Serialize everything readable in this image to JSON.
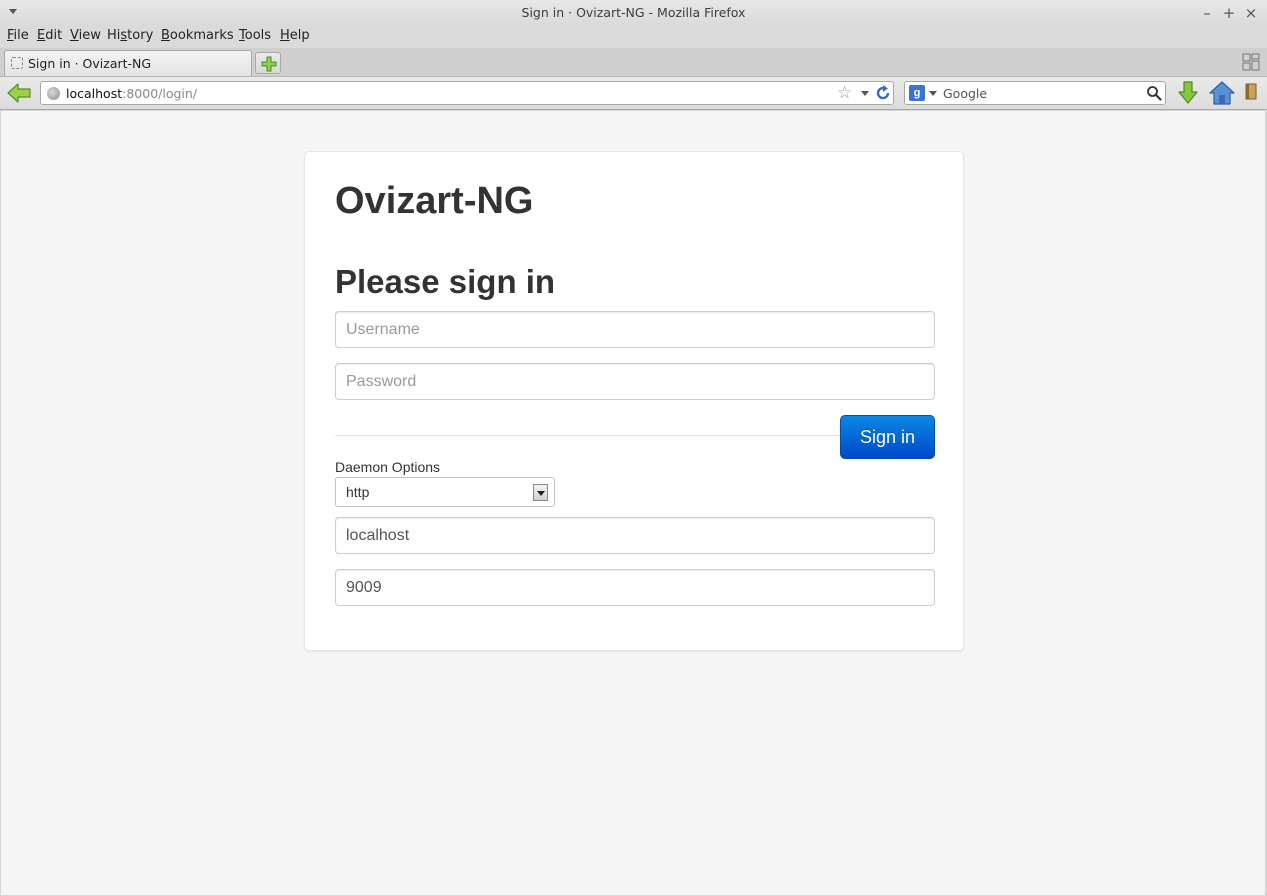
{
  "window": {
    "title": "Sign in · Ovizart-NG - Mozilla Firefox",
    "controls": {
      "minimize": "–",
      "maximize": "+",
      "close": "×"
    }
  },
  "menubar": {
    "items": [
      {
        "label": "File",
        "key": "F",
        "rest": "ile"
      },
      {
        "label": "Edit",
        "key": "E",
        "rest": "dit"
      },
      {
        "label": "View",
        "key": "V",
        "rest": "iew"
      },
      {
        "label": "History",
        "pre": "Hi",
        "key": "s",
        "rest": "tory"
      },
      {
        "label": "Bookmarks",
        "key": "B",
        "rest": "ookmarks"
      },
      {
        "label": "Tools",
        "key": "T",
        "rest": "ools"
      },
      {
        "label": "Help",
        "key": "H",
        "rest": "elp"
      }
    ]
  },
  "tabs": [
    {
      "label": "Sign in · Ovizart-NG"
    }
  ],
  "navbar": {
    "url_host": "localhost",
    "url_rest": ":8000/login/",
    "search_placeholder": "Google",
    "search_engine_letter": "g"
  },
  "icons": {
    "back": "back-arrow-icon",
    "site": "globe-icon",
    "bookmark": "star-icon",
    "reload": "reload-icon",
    "search": "magnifier-icon",
    "download": "download-arrow-icon",
    "home": "home-icon",
    "bookmarks_menu": "bookmarks-icon",
    "new_tab": "plus-icon",
    "tab_groups": "tab-groups-icon"
  },
  "colors": {
    "primary_button": "#0a6fd9",
    "page_background": "#f5f5f5",
    "card_background": "#ffffff",
    "text_dark": "#333333"
  },
  "page": {
    "brand": "Ovizart-NG",
    "heading": "Please sign in",
    "username_placeholder": "Username",
    "password_placeholder": "Password",
    "signin_label": "Sign in",
    "daemon_label": "Daemon Options",
    "daemon_protocol": "http",
    "daemon_host": "localhost",
    "daemon_port": "9009"
  }
}
